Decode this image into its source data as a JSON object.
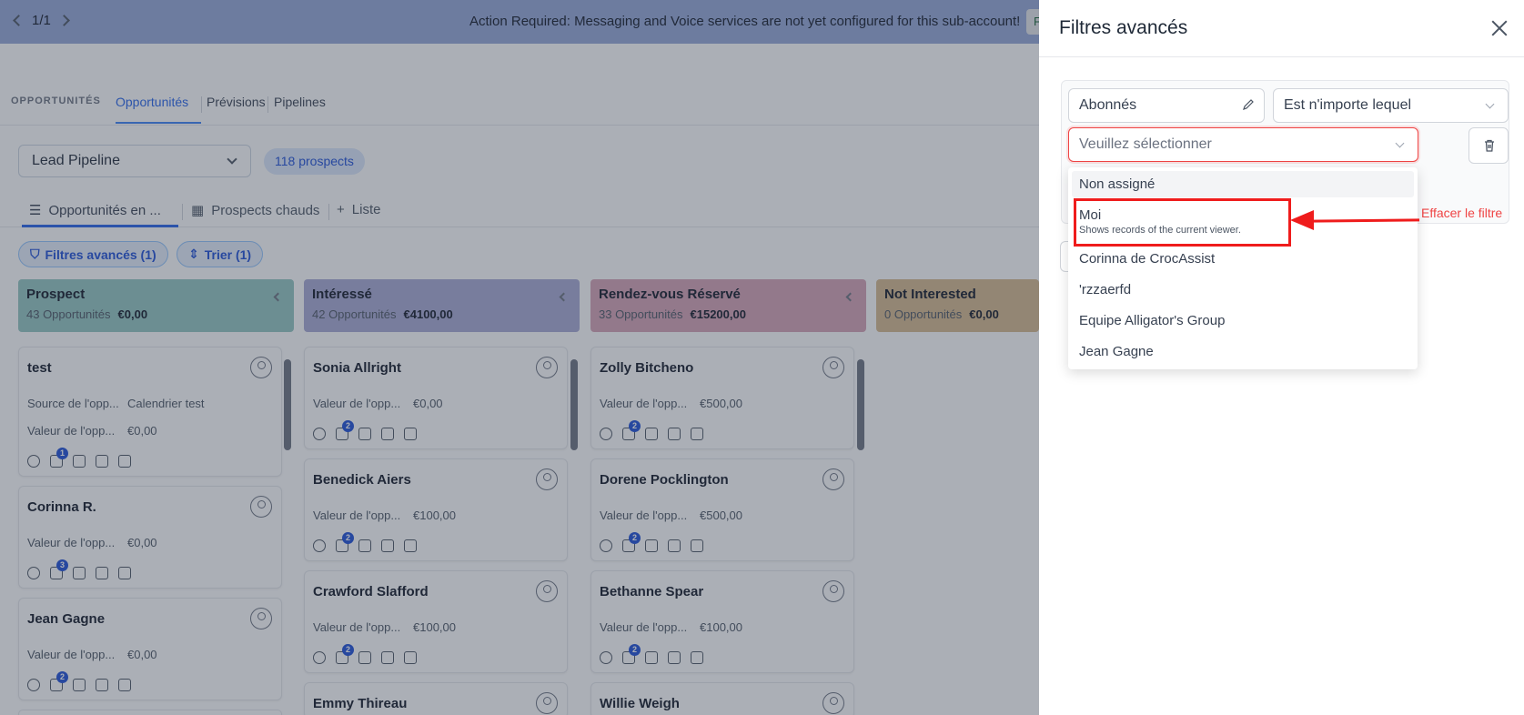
{
  "banner": {
    "pager": "1/1",
    "message": "Action Required: Messaging and Voice services are not yet configured for this sub-account!",
    "pill_text": "F"
  },
  "topnav": {
    "section": "OPPORTUNITÉS",
    "tabs": [
      "Opportunités",
      "Prévisions",
      "Pipelines"
    ]
  },
  "pipeline": {
    "selected": "Lead Pipeline",
    "count": "118 prospects"
  },
  "viewtabs": [
    "Opportunités en ...",
    "Prospects chauds",
    "Liste"
  ],
  "chips": {
    "filters": "Filtres avancés (1)",
    "sort": "Trier (1)"
  },
  "columns": [
    {
      "name": "Prospect",
      "count": "43 Opportunités",
      "value": "€0,00",
      "color": "#93c6c1"
    },
    {
      "name": "Intéressé",
      "count": "42 Opportunités",
      "value": "€4100,00",
      "color": "#a7a9d4"
    },
    {
      "name": "Rendez-vous Réservé",
      "count": "33 Opportunités",
      "value": "€15200,00",
      "color": "#d6a3b6"
    },
    {
      "name": "Not Interested",
      "count": "0 Opportunités",
      "value": "€0,00",
      "color": "#d6b98e"
    }
  ],
  "cards": [
    [
      {
        "title": "test",
        "rows": [
          {
            "label": "Source de l'opp...",
            "value": "Calendrier test"
          },
          {
            "label": "Valeur de l'opp...",
            "value": "€0,00"
          }
        ],
        "badge": "1"
      },
      {
        "title": "Corinna R.",
        "rows": [
          {
            "label": "Valeur de l'opp...",
            "value": "€0,00"
          }
        ],
        "badge": "3"
      },
      {
        "title": "Jean Gagne",
        "rows": [
          {
            "label": "Valeur de l'opp...",
            "value": "€0,00"
          }
        ],
        "badge": "2"
      }
    ],
    [
      {
        "title": "Sonia Allright",
        "rows": [
          {
            "label": "Valeur de l'opp...",
            "value": "€0,00"
          }
        ],
        "badge": "2"
      },
      {
        "title": "Benedick Aiers",
        "rows": [
          {
            "label": "Valeur de l'opp...",
            "value": "€100,00"
          }
        ],
        "badge": "2"
      },
      {
        "title": "Crawford Slafford",
        "rows": [
          {
            "label": "Valeur de l'opp...",
            "value": "€100,00"
          }
        ],
        "badge": "2"
      },
      {
        "title": "Emmy Thireau",
        "rows": [],
        "badge": ""
      }
    ],
    [
      {
        "title": "Zolly Bitcheno",
        "rows": [
          {
            "label": "Valeur de l'opp...",
            "value": "€500,00"
          }
        ],
        "badge": "2"
      },
      {
        "title": "Dorene Pocklington",
        "rows": [
          {
            "label": "Valeur de l'opp...",
            "value": "€500,00"
          }
        ],
        "badge": "2"
      },
      {
        "title": "Bethanne Spear",
        "rows": [
          {
            "label": "Valeur de l'opp...",
            "value": "€100,00"
          }
        ],
        "badge": "2"
      },
      {
        "title": "Willie Weigh",
        "rows": [],
        "badge": ""
      }
    ]
  ],
  "drawer": {
    "title": "Filtres avancés",
    "field": "Abonnés",
    "operator": "Est n'importe lequel",
    "value_placeholder": "Veuillez sélectionner",
    "clear_label": "Effacer le filtre",
    "options": [
      {
        "label": "Non assigné",
        "sub": ""
      },
      {
        "label": "Moi",
        "sub": "Shows records of the current viewer."
      },
      {
        "label": "Corinna de CrocAssist",
        "sub": ""
      },
      {
        "label": "'rzzaerfd",
        "sub": ""
      },
      {
        "label": "Equipe Alligator's Group",
        "sub": ""
      },
      {
        "label": "Jean Gagne",
        "sub": ""
      }
    ]
  },
  "accent_color": "#2563eb",
  "annotation_color": "#ef1c1c"
}
